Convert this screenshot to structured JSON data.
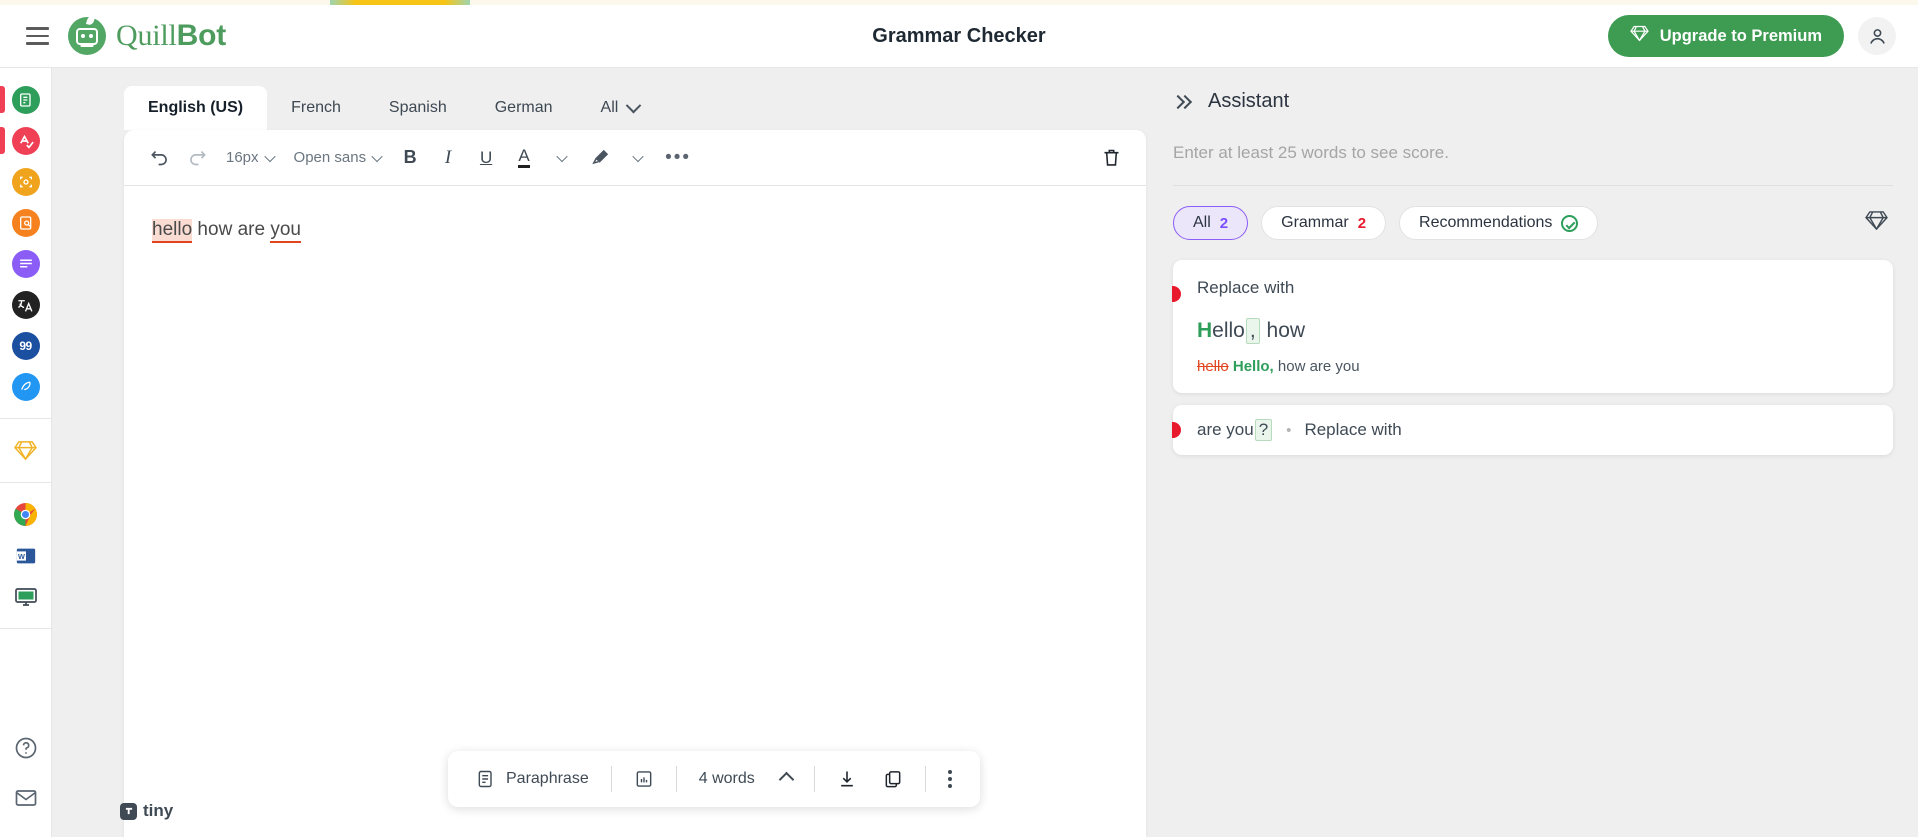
{
  "header": {
    "menu_icon": "hamburger-icon",
    "brand_first": "Quill",
    "brand_second": "Bot",
    "title": "Grammar Checker",
    "upgrade_label": "Upgrade to Premium",
    "upgrade_icon": "diamond-icon",
    "account_icon": "user-avatar-icon",
    "upgrade_color": "#3d9b52"
  },
  "sidebar": {
    "tools": [
      {
        "name": "paraphraser-icon",
        "glyph": "✎",
        "color": "green",
        "active": false
      },
      {
        "name": "grammar-checker-icon",
        "glyph": "A",
        "color": "red",
        "active": true
      },
      {
        "name": "ai-detector-icon",
        "glyph": "◆",
        "color": "amber",
        "active": false
      },
      {
        "name": "plagiarism-checker-icon",
        "glyph": "⌕",
        "color": "orange",
        "active": false
      },
      {
        "name": "summarizer-icon",
        "glyph": "≡",
        "color": "purple",
        "active": false
      },
      {
        "name": "translator-icon",
        "glyph": "A",
        "color": "black",
        "active": false
      },
      {
        "name": "citation-generator-icon",
        "glyph": "99",
        "color": "navy",
        "active": false
      },
      {
        "name": "ai-writer-icon",
        "glyph": "✎",
        "color": "blue",
        "active": false
      }
    ],
    "premium": {
      "name": "premium-diamond-icon",
      "glyph": "◆"
    },
    "apps": [
      {
        "name": "chrome-extension-icon",
        "glyph": "●"
      },
      {
        "name": "word-addin-icon",
        "glyph": "W"
      },
      {
        "name": "macos-app-icon",
        "glyph": "▣"
      }
    ],
    "help": [
      {
        "name": "help-icon",
        "glyph": "?"
      },
      {
        "name": "mail-icon",
        "glyph": "✉"
      }
    ]
  },
  "editor": {
    "tabs": [
      {
        "label": "English (US)",
        "active": true
      },
      {
        "label": "French",
        "active": false
      },
      {
        "label": "Spanish",
        "active": false
      },
      {
        "label": "German",
        "active": false
      },
      {
        "label": "All",
        "active": false,
        "has_chevron": true
      }
    ],
    "toolbar": {
      "undo_icon": "undo-icon",
      "redo_icon": "redo-icon",
      "font_size": "16px",
      "font_family": "Open sans",
      "bold_label": "B",
      "italic_label": "I",
      "underline_label": "U",
      "text_color_label": "A",
      "highlight_icon": "highlighter-icon",
      "more_icon": "more-horizontal-icon",
      "trash_icon": "trash-icon"
    },
    "content": {
      "word_error": "hello",
      "middle": " how are ",
      "word_error2": "you"
    }
  },
  "floatbar": {
    "paraphrase_icon": "paraphrase-icon",
    "paraphrase_label": "Paraphrase",
    "stats_icon": "stats-icon",
    "word_count": "4 words",
    "expand_icon": "caret-up-icon",
    "download_icon": "download-icon",
    "copy_icon": "copy-icon",
    "more_icon": "more-vertical-icon"
  },
  "tiny_logo": {
    "label": "tiny",
    "icon": "tiny-logo-icon"
  },
  "assistant": {
    "collapse_icon": "double-chevron-right-icon",
    "title": "Assistant",
    "score_note": "Enter at least 25 words to see score.",
    "filters": [
      {
        "label": "All",
        "count": "2",
        "count_color": "purple",
        "active": true
      },
      {
        "label": "Grammar",
        "count": "2",
        "count_color": "red",
        "active": false
      },
      {
        "label": "Recommendations",
        "icon": "check-circle-icon",
        "active": false
      }
    ],
    "premium_icon": "diamond-icon",
    "cards": [
      {
        "type": "expanded",
        "label": "Replace with",
        "main_prefix_highlight": "H",
        "main_prefix": "ello",
        "main_boxed": ",",
        "main_suffix": " how",
        "sub_deleted": "hello",
        "sub_added": "Hello,",
        "sub_rest": " how are you"
      },
      {
        "type": "compact",
        "inline_text": "are you",
        "inline_boxed": "?",
        "separator": "•",
        "label": "Replace with"
      }
    ]
  }
}
